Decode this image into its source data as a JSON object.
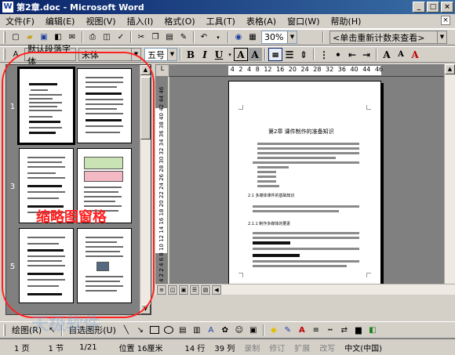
{
  "window": {
    "title": "第2章.doc - Microsoft Word",
    "app_icon": "W"
  },
  "menu": [
    "文件(F)",
    "编辑(E)",
    "视图(V)",
    "插入(I)",
    "格式(O)",
    "工具(T)",
    "表格(A)",
    "窗口(W)",
    "帮助(H)"
  ],
  "toolbar": {
    "zoom": "30%",
    "recount_box": "<单击重新计数来查看>"
  },
  "formatting": {
    "style": "默认段落字体",
    "font": "宋体",
    "size": "五号",
    "bold": "B",
    "italic": "I",
    "underline": "U",
    "font_A": "A",
    "font_A2": "A"
  },
  "thumbnails": {
    "annotation": "缩略图窗格",
    "page_numbers": [
      "1",
      "3",
      "5"
    ]
  },
  "ruler": {
    "h_ticks": [
      "4",
      "2",
      "2",
      "4",
      "6",
      "8",
      "10",
      "12",
      "14",
      "16",
      "18",
      "20",
      "22",
      "24",
      "26",
      "28",
      "30",
      "32",
      "34",
      "36",
      "38",
      "40",
      "42",
      "44",
      "46"
    ],
    "v_ticks": "4 2   2 4 6 8 10 12 14 16 18 20 22 24 26 28 30 32 34 36 38 40 42 44 46"
  },
  "document": {
    "chapter_title": "第2章   课件制作的准备知识",
    "heading1": "2.1 多媒体课件的基础知识",
    "heading2": "2.1.1 制作多媒体的要素"
  },
  "drawbar": {
    "draw_label": "绘图(R)",
    "autoshape_label": "自选图形(U)"
  },
  "status": {
    "page": "1 页",
    "section": "1 节",
    "page_of": "1/21",
    "position": "位置 16厘米",
    "line": "14 行",
    "column": "39 列",
    "rec": "录制",
    "trk": "修订",
    "ext": "扩展",
    "ovr": "改写",
    "lang": "中文(中国)"
  },
  "watermark": "天极软件"
}
